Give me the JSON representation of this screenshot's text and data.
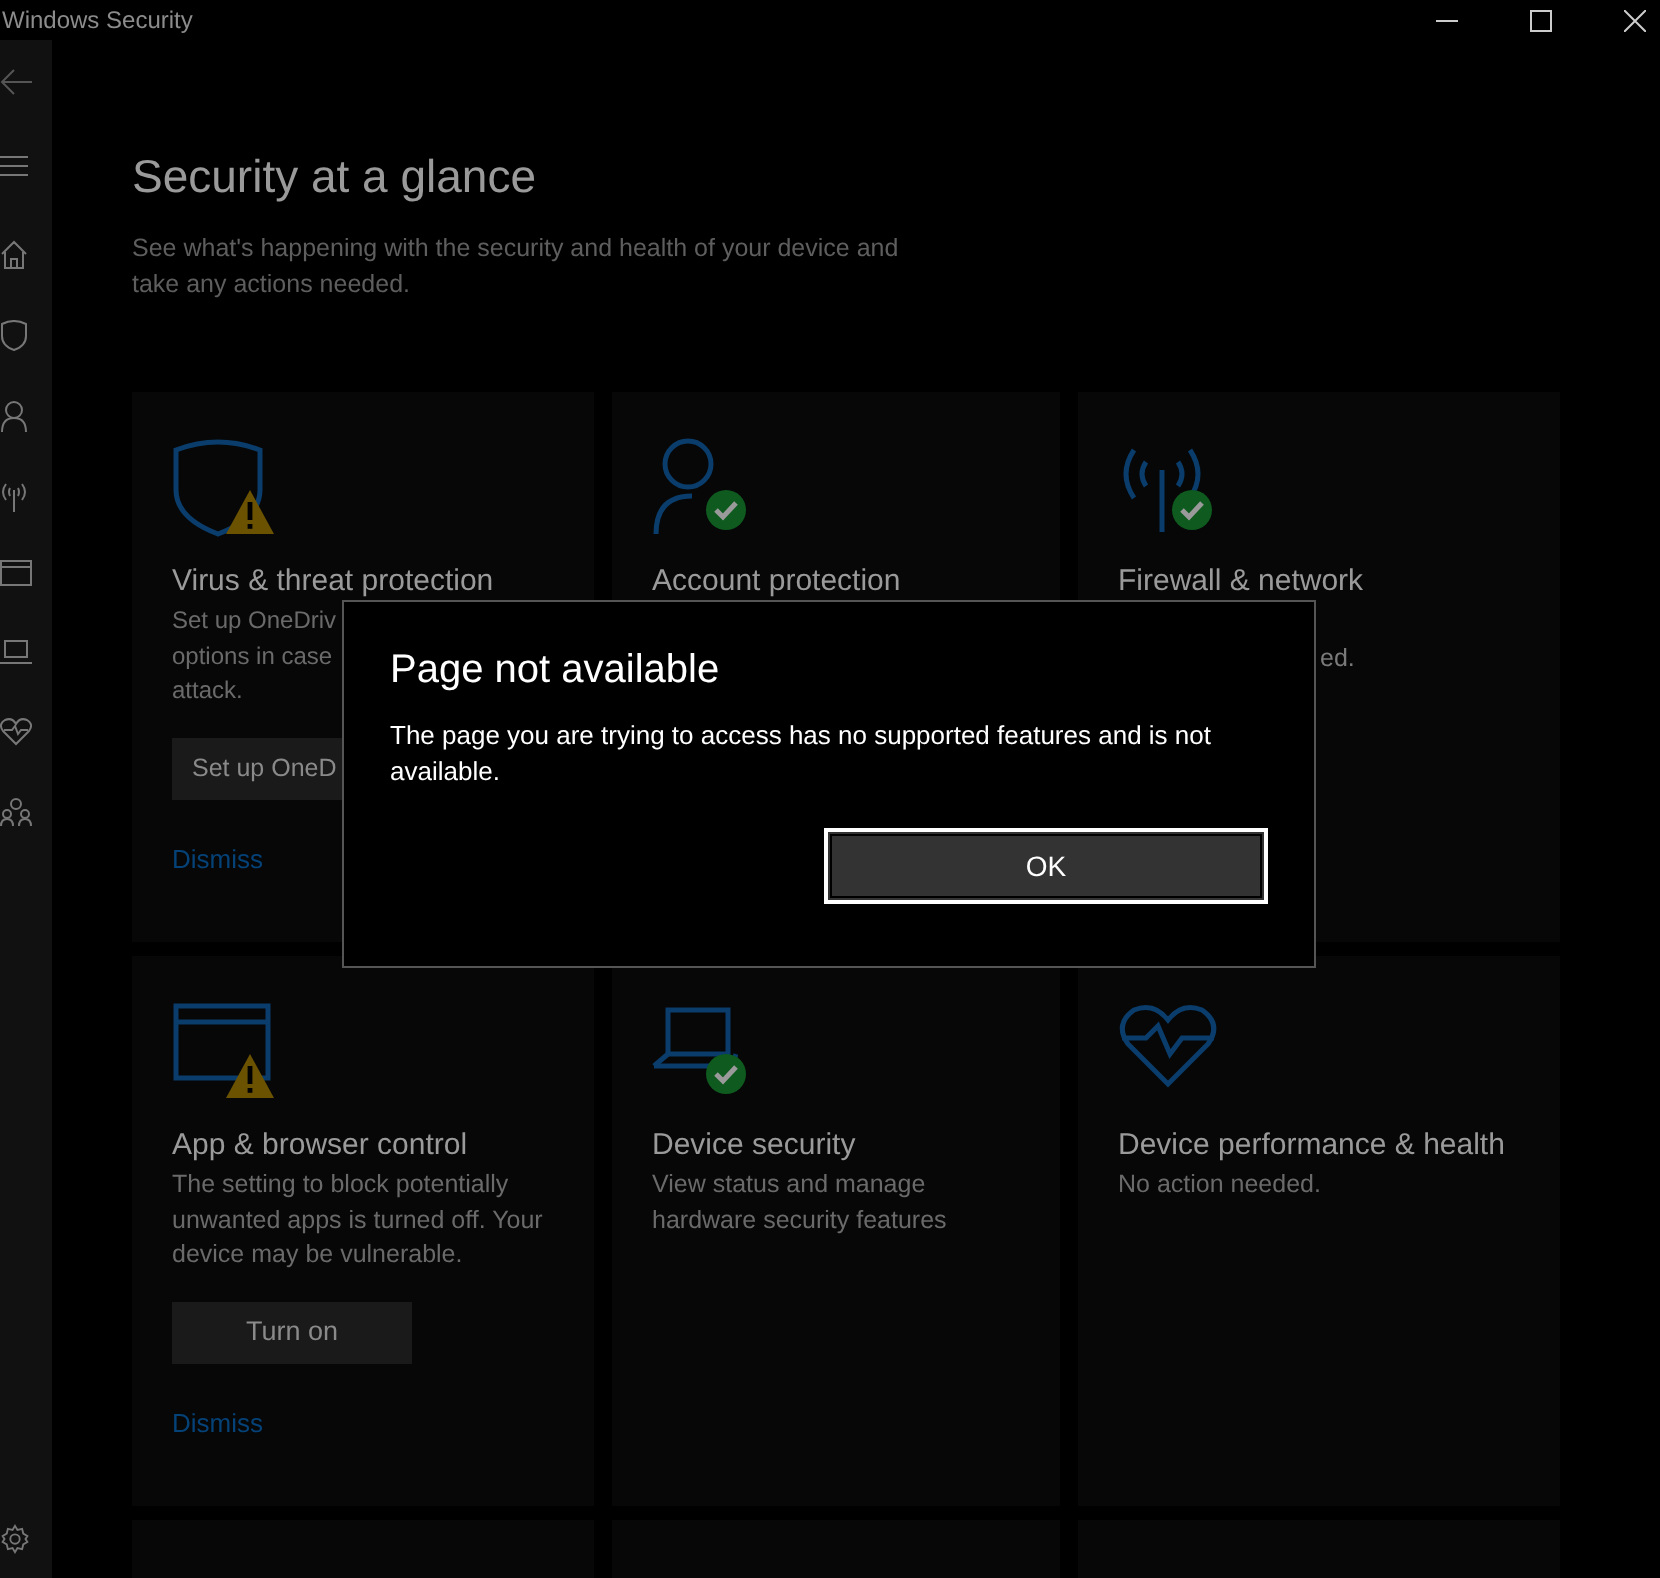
{
  "window": {
    "title": "Windows Security"
  },
  "page": {
    "title": "Security at a glance",
    "subtitle": "See what's happening with the security and health of your device and take any actions needed."
  },
  "tiles": [
    {
      "kind": "shield",
      "warning": true,
      "healthy": false,
      "title": "Virus & threat protection",
      "description": "Set up OneDriv\noptions in case\nattack.",
      "button": "Set up OneD",
      "link": "Dismiss"
    },
    {
      "kind": "person",
      "warning": false,
      "healthy": true,
      "title": "Account protection"
    },
    {
      "kind": "antenna",
      "warning": false,
      "healthy": true,
      "title": "Firewall & network",
      "description_tail": "ed."
    },
    {
      "kind": "browser",
      "warning": true,
      "healthy": false,
      "title": "App & browser control",
      "description": "The setting to block potentially unwanted apps is turned off. Your device may be vulnerable.",
      "button": "Turn on",
      "link": "Dismiss"
    },
    {
      "kind": "laptop",
      "warning": false,
      "healthy": true,
      "title": "Device security",
      "description": "View status and manage hardware security features"
    },
    {
      "kind": "heart",
      "warning": false,
      "healthy": false,
      "title": "Device performance & health",
      "description": "No action needed."
    }
  ],
  "dialog": {
    "title": "Page not available",
    "message": "The page you are trying to access has no supported features and is not available.",
    "button": "OK"
  }
}
